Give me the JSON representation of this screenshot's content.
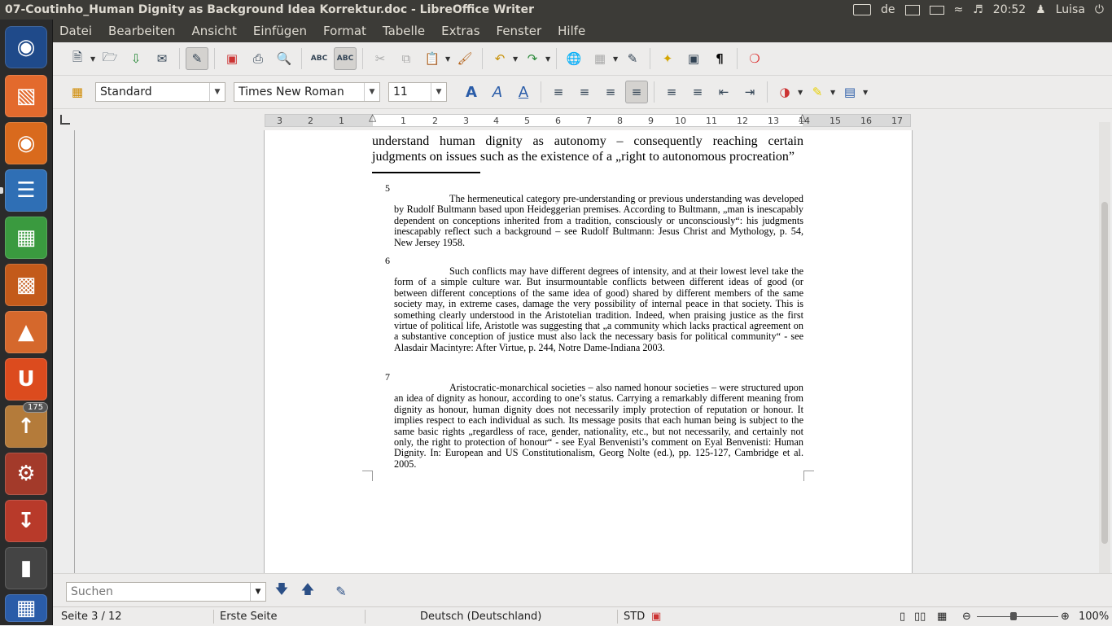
{
  "window": {
    "title": "07-Coutinho_Human Dignity as Background Idea Korrektur.doc - LibreOffice Writer"
  },
  "indicators": {
    "keyboard_layout": "de",
    "time": "20:52",
    "user": "Luisa"
  },
  "launcher": {
    "update_badge": "175",
    "items": [
      "ubuntu-logo-icon",
      "files-icon",
      "firefox-icon",
      "writer-icon",
      "calc-icon",
      "impress-icon",
      "software-center-icon",
      "ubuntu-one-icon",
      "update-manager-icon",
      "system-settings-icon",
      "usb-creator-icon",
      "video-editor-icon",
      "workspace-switcher-icon"
    ]
  },
  "menubar": {
    "items": [
      "Datei",
      "Bearbeiten",
      "Ansicht",
      "Einfügen",
      "Format",
      "Tabelle",
      "Extras",
      "Fenster",
      "Hilfe"
    ]
  },
  "formatting": {
    "paragraph_style": "Standard",
    "font_name": "Times New Roman",
    "font_size": "11"
  },
  "ruler": {
    "ticks": [
      "3",
      "2",
      "1",
      "1",
      "2",
      "3",
      "4",
      "5",
      "6",
      "7",
      "8",
      "9",
      "10",
      "11",
      "12",
      "13",
      "14",
      "15",
      "16",
      "17"
    ]
  },
  "document": {
    "body_lines": [
      "understand human dignity as autonomy – consequently reaching certain",
      "judgments on issues such as the existence of a „right to autonomous procreation”"
    ],
    "footnotes": [
      {
        "number": "5",
        "text": "The hermeneutical category pre-understanding or previous understanding was developed by Rudolf Bultmann based upon Heideggerian premises. According to Bultmann, „man is inescapably dependent on conceptions inherited from a tradition, consciously or unconsciously“: his judgments inescapably reflect such a background – see Rudolf Bultmann: Jesus Christ and Mythology, p. 54, New Jersey 1958."
      },
      {
        "number": "6",
        "text": "Such conflicts may have different degrees of intensity, and at their lowest level take the form of a simple culture war. But insurmountable conflicts between different ideas of good (or between different conceptions of the same idea of good) shared by different members of the same society may, in extreme cases, damage the very possibility of internal peace in that society. This is something clearly understood in the Aristotelian tradition. Indeed, when praising justice as the first virtue of political life, Aristotle was suggesting that „a community which lacks practical agreement on a substantive conception of justice must also lack the necessary basis for political community“ - see Alasdair Macintyre: After Virtue, p. 244, Notre Dame-Indiana 2003."
      },
      {
        "number": "7",
        "text": "Aristocratic-monarchical societies – also named honour societies – were structured upon an idea of dignity as honour, according to one’s status. Carrying a remarkably different meaning from dignity as honour, human dignity does not necessarily imply protection of reputation or honour. It implies respect to each individual as such. Its message posits that each human being is subject to the same basic rights „regardless of race, gender, nationality, etc., but not necessarily, and certainly not only, the right to protection of honour“ - see Eyal Benvenisti’s comment on Eyal Benvenisti: Human Dignity. In: European and US Constitutionalism, Georg Nolte (ed.), pp. 125-127, Cambridge et al. 2005."
      }
    ]
  },
  "findbar": {
    "placeholder": "Suchen"
  },
  "statusbar": {
    "page": "Seite 3 / 12",
    "page_style": "Erste Seite",
    "language": "Deutsch (Deutschland)",
    "selection_mode": "STD",
    "zoom": "100%",
    "zoom_level": 100
  }
}
